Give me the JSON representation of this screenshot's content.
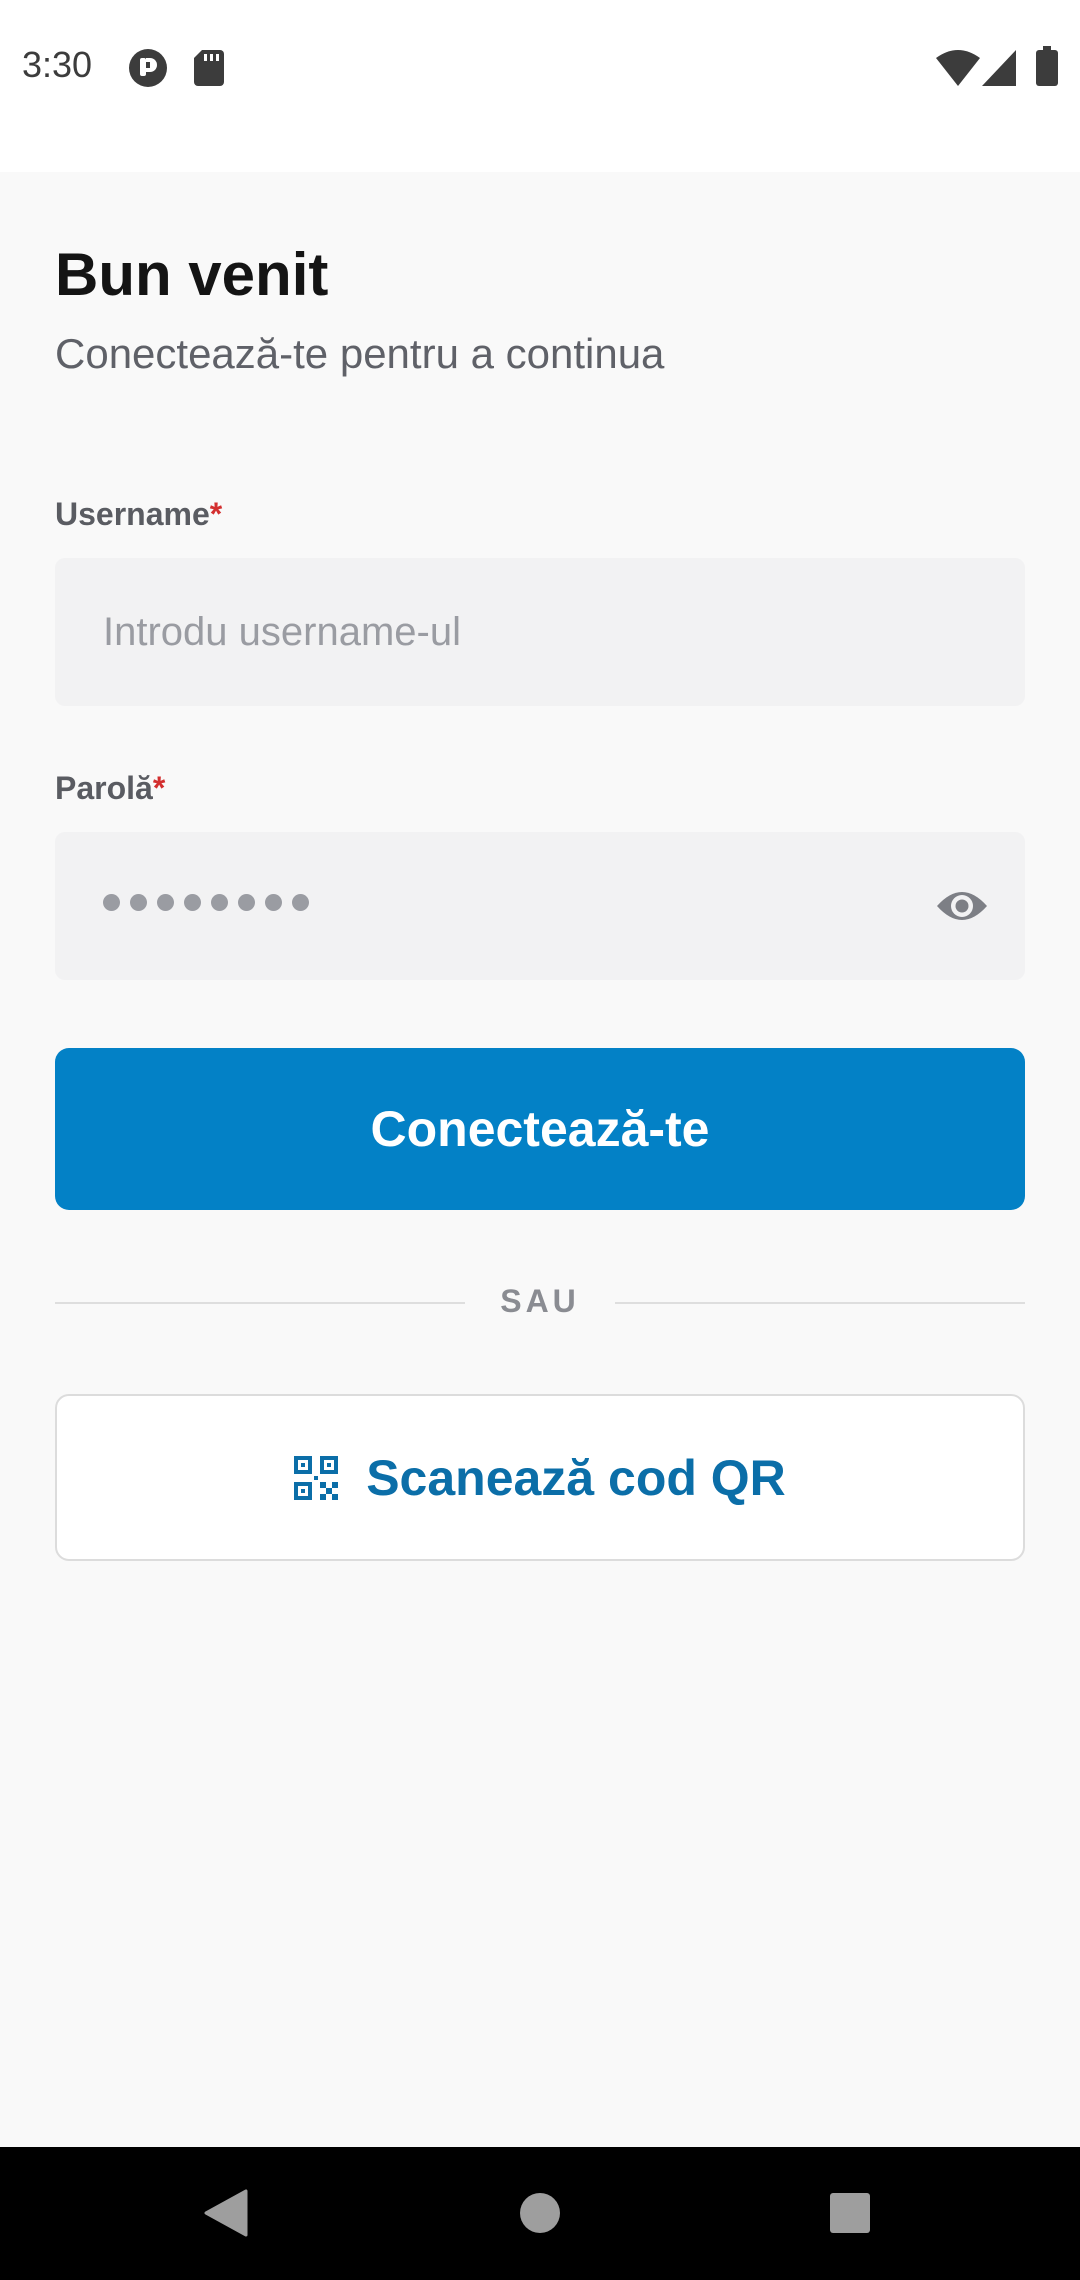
{
  "status_bar": {
    "time": "3:30",
    "icons": [
      "app-notification-icon",
      "sd-card-icon",
      "wifi-icon",
      "cell-signal-icon",
      "battery-icon"
    ]
  },
  "header": {
    "title": "Bun venit",
    "subtitle": "Conectează-te pentru a continua"
  },
  "form": {
    "username": {
      "label": "Username",
      "required_mark": "*",
      "placeholder": "Introdu username-ul",
      "value": ""
    },
    "password": {
      "label": "Parolă",
      "required_mark": "*",
      "masked_length": 8,
      "toggle_icon": "eye-icon"
    },
    "submit_label": "Conectează-te"
  },
  "divider": {
    "text": "SAU"
  },
  "qr_button": {
    "label": "Scanează cod QR",
    "icon": "qr-code-icon"
  },
  "nav_bar": {
    "buttons": [
      "back-icon",
      "home-icon",
      "recents-icon"
    ]
  },
  "colors": {
    "primary": "#0381c6",
    "qr_text": "#0b6ea8",
    "required": "#d32f2f",
    "background": "#f9f9f9"
  }
}
